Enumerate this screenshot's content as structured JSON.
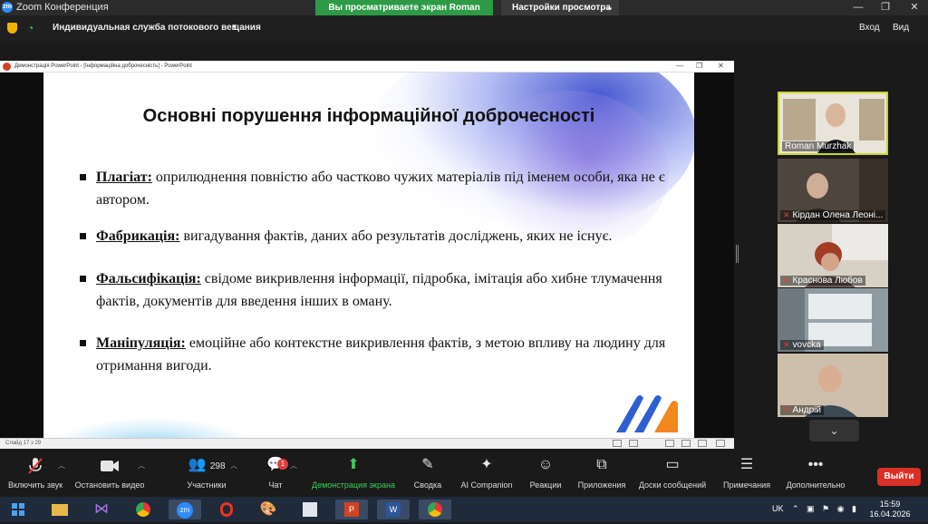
{
  "window": {
    "title": "Zoom Конференция",
    "share_banner": "Вы просматриваете экран Roman Murzhak",
    "view_settings": "Настройки просмотра"
  },
  "infobar": {
    "stream_label": "Индивидуальная служба потокового вещания",
    "exit_label": "Вход",
    "view_label": "Вид"
  },
  "ppt": {
    "window_title": "Демонстрація PowerPoint - [Інформаційна доброчесність] - PowerPoint",
    "status_text": "Слайд 17 з 29"
  },
  "slide": {
    "title": "Основні порушення інформаційної доброчесності",
    "bullets": [
      {
        "term": "Плагіат:",
        "text": " оприлюднення повністю або частково чужих матеріалів під іменем особи, яка не є автором."
      },
      {
        "term": "Фабрикація:",
        "text": " вигадування фактів, даних або результатів досліджень, яких не існує."
      },
      {
        "term": "Фальсифікація:",
        "text": " свідоме викривлення інформації, підробка, імітація або хибне тлумачення фактів, документів для введення інших в оману."
      },
      {
        "term": "Маніпуляція:",
        "text": " емоційне або контекстне викривлення фактів, з метою впливу на людину для отримання вигоди."
      }
    ],
    "logo_colors": {
      "blue": "#2d5fd3",
      "orange": "#f2871f"
    }
  },
  "participants": [
    {
      "name": "Roman Murzhak",
      "muted": false
    },
    {
      "name": "Кірдан Олена Леоні...",
      "muted": true
    },
    {
      "name": "Краснова Любов",
      "muted": true
    },
    {
      "name": "vovcka",
      "muted": true
    },
    {
      "name": "Андрій",
      "muted": true
    }
  ],
  "toolbar": {
    "audio": "Включить звук",
    "video": "Остановить видео",
    "participants": "Участники",
    "participants_count": "298",
    "chat": "Чат",
    "chat_badge": "1",
    "share": "Демонстрация экрана",
    "summary": "Сводка",
    "ai": "AI Companion",
    "reactions": "Реакции",
    "apps": "Приложения",
    "whiteboards": "Доски сообщений",
    "notes": "Примечания",
    "more": "Дополнительно",
    "leave": "Выйти"
  },
  "taskbar": {
    "language": "UK",
    "time": "15:59",
    "date": "16.04.2026"
  }
}
